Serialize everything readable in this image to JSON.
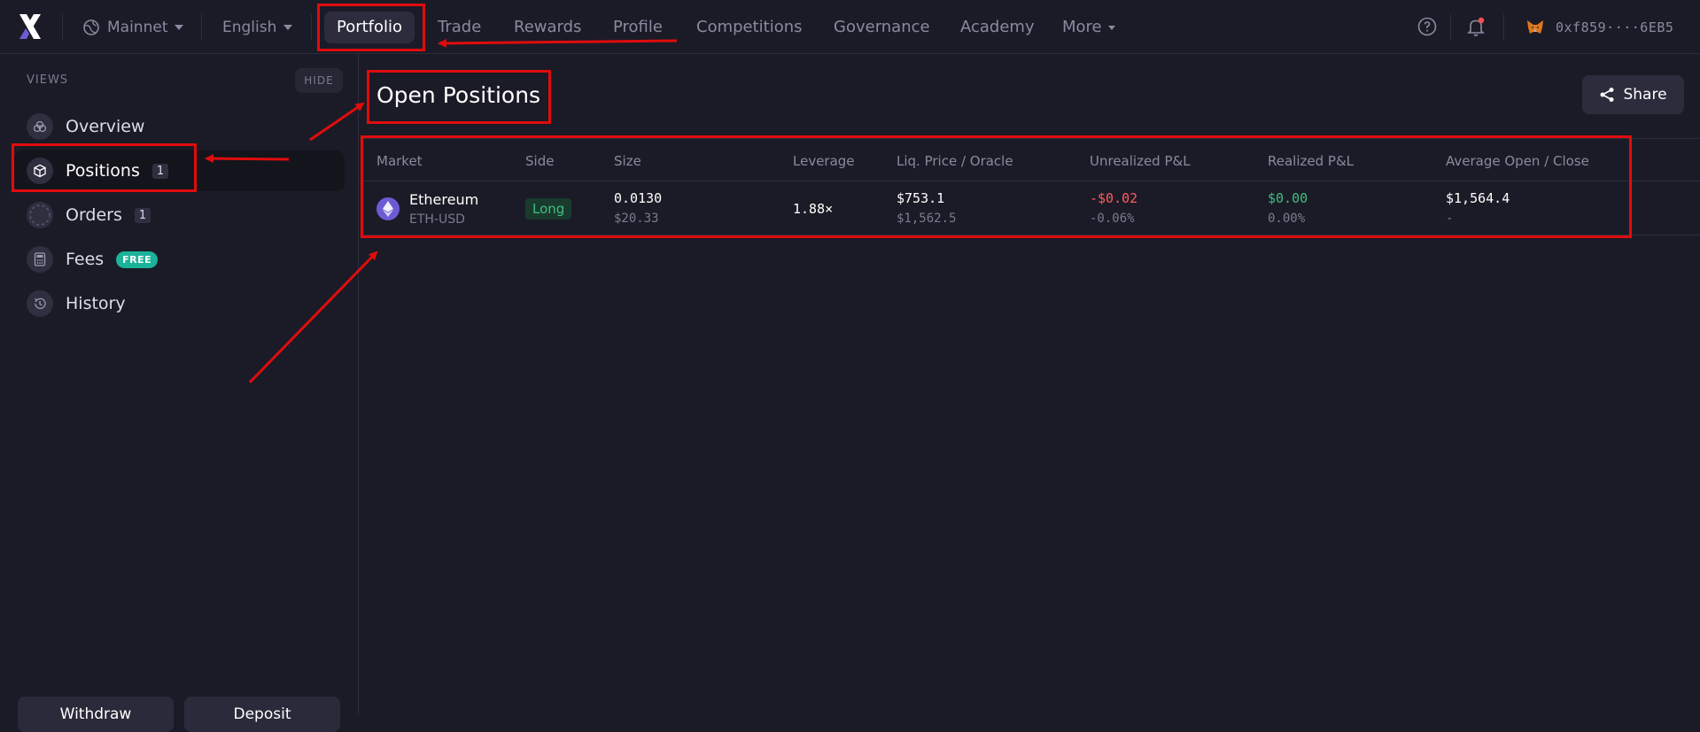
{
  "nav": {
    "network": "Mainnet",
    "language": "English",
    "items": [
      {
        "label": "Portfolio",
        "active": true
      },
      {
        "label": "Trade"
      },
      {
        "label": "Rewards"
      },
      {
        "label": "Profile"
      },
      {
        "label": "Competitions"
      },
      {
        "label": "Governance"
      },
      {
        "label": "Academy"
      },
      {
        "label": "More"
      }
    ],
    "wallet_address": "0xf859····6EB5",
    "icons": [
      "help-icon",
      "notification-bell-icon",
      "metamask-fox-icon"
    ]
  },
  "sidebar": {
    "section_label": "VIEWS",
    "hide_label": "HIDE",
    "items": [
      {
        "label": "Overview",
        "icon": "overview-icon"
      },
      {
        "label": "Positions",
        "icon": "cube-icon",
        "badge": "1",
        "active": true
      },
      {
        "label": "Orders",
        "icon": "orders-icon",
        "badge": "1"
      },
      {
        "label": "Fees",
        "icon": "calculator-icon",
        "badge": "FREE"
      },
      {
        "label": "History",
        "icon": "history-icon"
      }
    ],
    "bottom_buttons": [
      "Withdraw",
      "Deposit"
    ]
  },
  "main": {
    "title": "Open Positions",
    "share_label": "Share",
    "columns": [
      "Market",
      "Side",
      "Size",
      "Leverage",
      "Liq. Price / Oracle",
      "Unrealized P&L",
      "Realized P&L",
      "Average Open / Close"
    ],
    "rows": [
      {
        "market_name": "Ethereum",
        "market_pair": "ETH-USD",
        "side": "Long",
        "size": "0.0130",
        "size_usd": "$20.33",
        "leverage": "1.88×",
        "liq_price": "$753.1",
        "oracle_price": "$1,562.5",
        "unrealized_pnl": "-$0.02",
        "unrealized_pct": "-0.06%",
        "realized_pnl": "$0.00",
        "realized_pct": "0.00%",
        "avg_open": "$1,564.4",
        "avg_close": "-"
      }
    ]
  },
  "colors": {
    "background": "#1b1b27",
    "border": "#2c2c3d",
    "accent_green": "#3fbf7f",
    "accent_red": "#ff5c5c",
    "annotation_red": "#e00c0c",
    "free_badge": "#1bb39a"
  }
}
